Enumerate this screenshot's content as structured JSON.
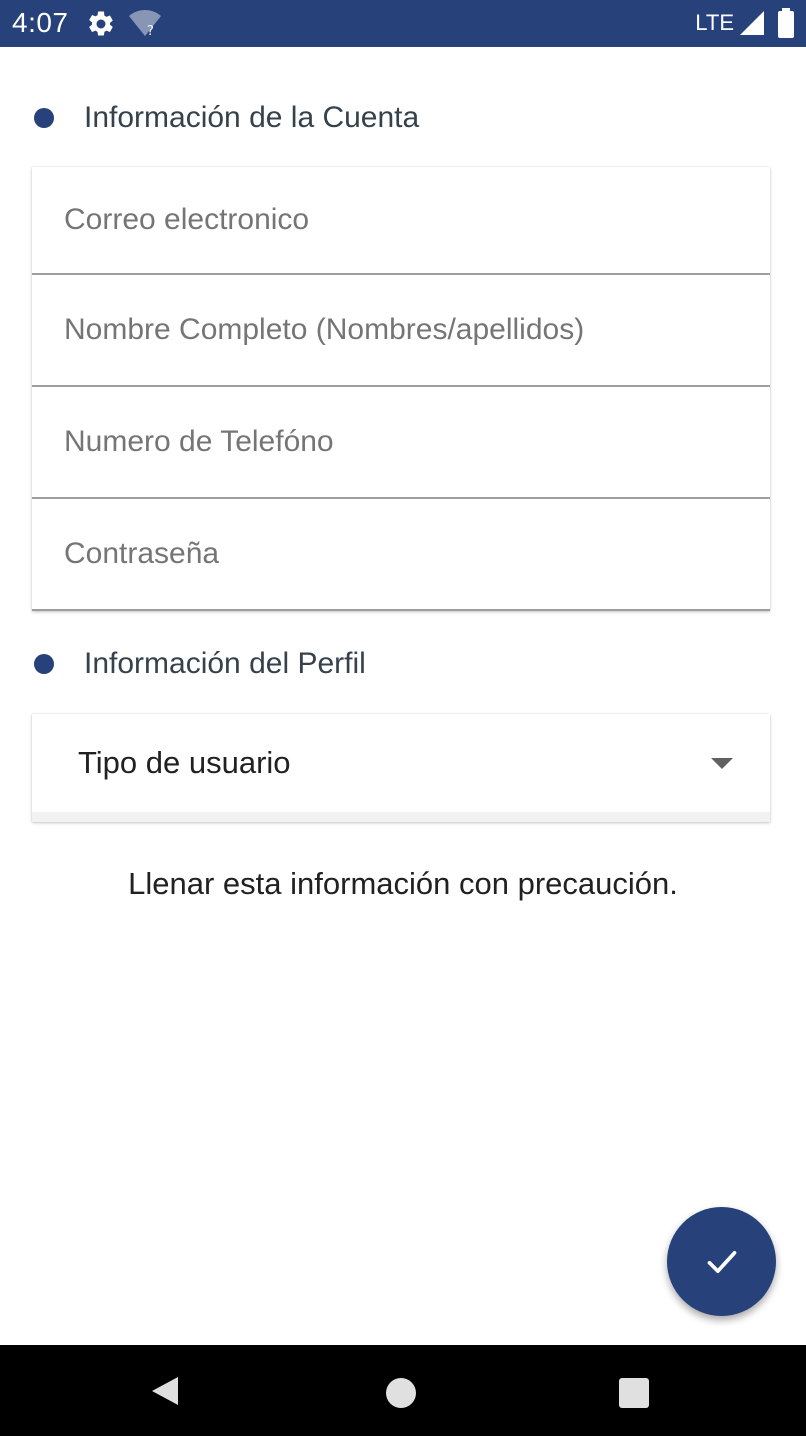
{
  "status_bar": {
    "time": "4:07",
    "network": "LTE",
    "icons": [
      "gear-icon",
      "wifi-unknown-icon",
      "signal-icon",
      "battery-icon"
    ]
  },
  "sections": {
    "account": {
      "title": "Información de la Cuenta",
      "fields": [
        {
          "placeholder": "Correo electronico",
          "value": ""
        },
        {
          "placeholder": "Nombre Completo (Nombres/apellidos)",
          "value": ""
        },
        {
          "placeholder": "Numero de Telefóno",
          "value": ""
        },
        {
          "placeholder": "Contraseña",
          "value": ""
        }
      ]
    },
    "profile": {
      "title": "Información del Perfil",
      "dropdown_value": "Tipo de usuario"
    }
  },
  "note": "Llenar esta información con precaución.",
  "fab_icon": "check-icon",
  "colors": {
    "primary": "#27417a",
    "field_text": "#757575",
    "divider": "#9e9e9e"
  }
}
